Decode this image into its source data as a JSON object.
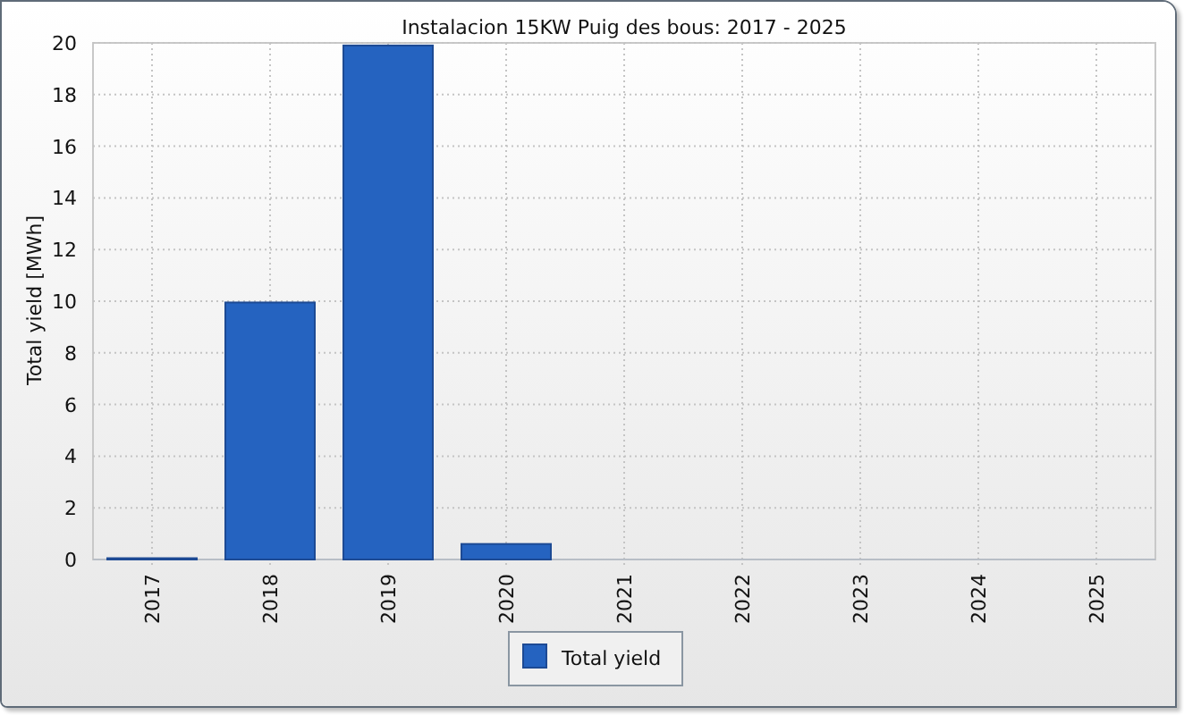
{
  "chart_data": {
    "type": "bar",
    "title": "Instalacion 15KW Puig des bous: 2017 - 2025",
    "ylabel": "Total yield [MWh]",
    "categories": [
      "2017",
      "2018",
      "2019",
      "2020",
      "2021",
      "2022",
      "2023",
      "2024",
      "2025"
    ],
    "series": [
      {
        "name": "Total yield",
        "color": "#2563c0",
        "values": [
          0.05,
          9.95,
          19.9,
          0.6,
          0,
          0,
          0,
          0,
          0
        ]
      }
    ],
    "ylim": [
      0,
      20
    ],
    "grid": true,
    "yticks": [
      0,
      2,
      4,
      6,
      8,
      10,
      12,
      14,
      16,
      18,
      20
    ]
  }
}
